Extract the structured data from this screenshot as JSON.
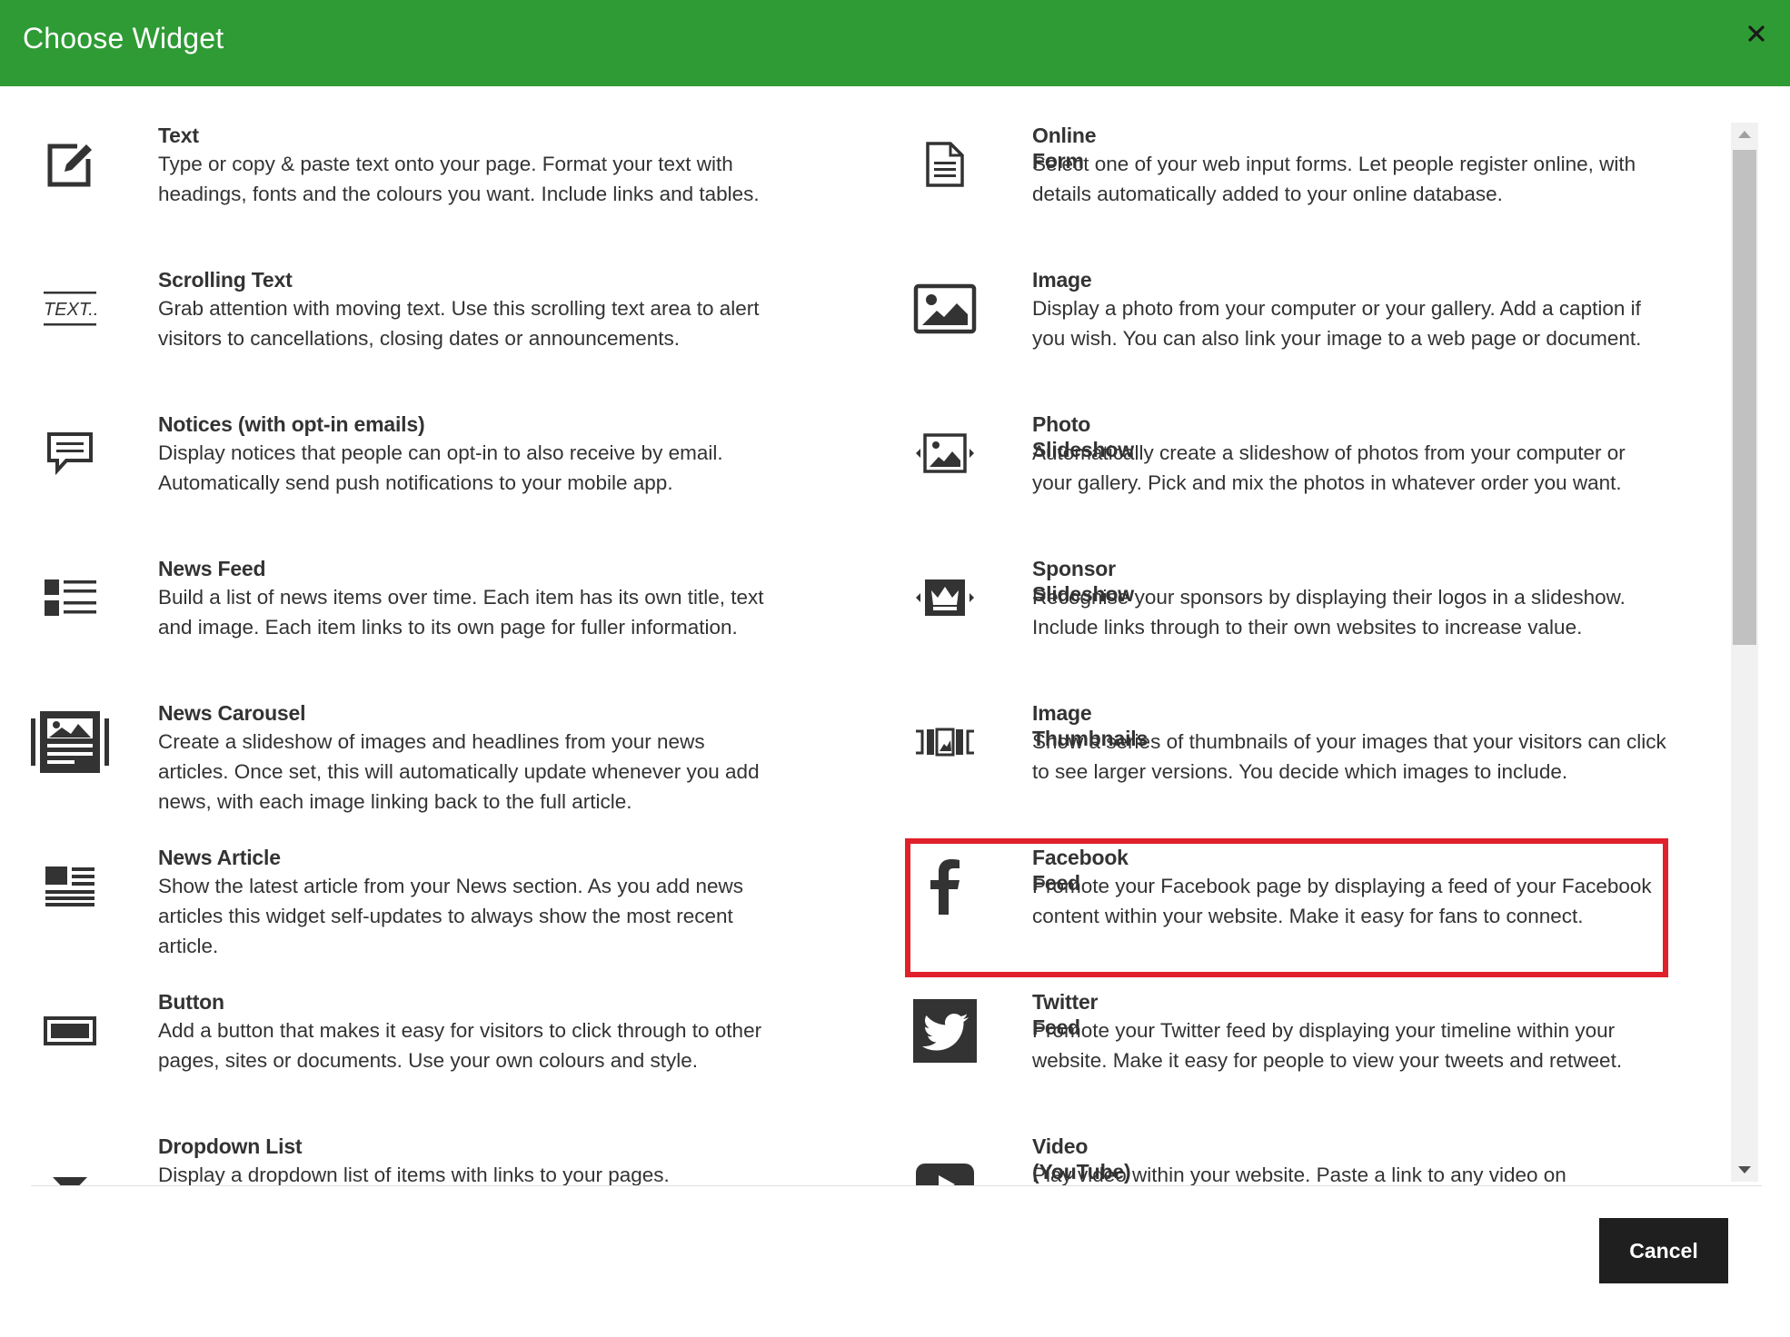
{
  "dialog": {
    "title": "Choose Widget",
    "close_icon": "close-icon",
    "cancel_label": "Cancel",
    "accent_color": "#2e9b35",
    "highlight_color": "#e0202a"
  },
  "widgets_left": [
    {
      "title": "Text",
      "desc": "Type or copy & paste text onto your page. Format your text with headings, fonts and the colours you want. Include links and tables.",
      "icon": "edit-icon"
    },
    {
      "title": "Scrolling Text",
      "desc": "Grab attention with moving text. Use this scrolling text area to alert visitors to cancellations, closing dates or announcements.",
      "icon": "scrolling-text-icon",
      "icon_text": "TEXT..."
    },
    {
      "title": "Notices (with opt-in emails)",
      "desc": "Display notices that people can opt-in to also receive by email. Automatically send push notifications to your mobile app.",
      "icon": "comment-icon"
    },
    {
      "title": "News Feed",
      "desc": "Build a list of news items over time. Each item has its own title, text and image. Each item links to its own page for fuller information.",
      "icon": "list-icon"
    },
    {
      "title": "News Carousel",
      "desc": "Create a slideshow of images and headlines from your news articles. Once set, this will automatically update whenever you add news, with each image linking back to the full article.",
      "icon": "carousel-icon"
    },
    {
      "title": "News Article",
      "desc": "Show the latest article from your News section. As you add news articles this widget self-updates to always show the most recent article.",
      "icon": "article-icon"
    },
    {
      "title": "Button",
      "desc": "Add a button that makes it easy for visitors to click through to other pages, sites or documents. Use your own colours and style.",
      "icon": "button-icon"
    },
    {
      "title": "Dropdown List",
      "desc": "Display a dropdown list of items with links to your pages.",
      "icon": "caret-down-icon"
    }
  ],
  "widgets_right": [
    {
      "title": "Online Form",
      "desc": "Select one of your web input forms. Let people register online, with details automatically added to your online database.",
      "icon": "document-icon"
    },
    {
      "title": "Image",
      "desc": "Display a photo from your computer or your gallery. Add a caption if you wish. You can also link your image to a web page or document.",
      "icon": "image-icon"
    },
    {
      "title": "Photo Slideshow",
      "desc": "Automatically create a slideshow of photos from your computer or your gallery. Pick and mix the photos in whatever order you want.",
      "icon": "photo-slideshow-icon"
    },
    {
      "title": "Sponsor Slideshow",
      "desc": "Recognise your sponsors by displaying their logos in a slideshow. Include links through to their own websites to increase value.",
      "icon": "sponsor-slideshow-icon"
    },
    {
      "title": "Image Thumbnails",
      "desc": "Show a series of thumbnails of your images that your visitors can click to see larger versions. You decide which images to include.",
      "icon": "thumbnails-icon"
    },
    {
      "title": "Facebook Feed",
      "desc": "Promote your Facebook page by displaying a feed of your Facebook content within your website. Make it easy for fans to connect.",
      "icon": "facebook-icon"
    },
    {
      "title": "Twitter Feed",
      "desc": "Promote your Twitter feed by displaying your timeline within your website. Make it easy for people to view your tweets and retweet.",
      "icon": "twitter-icon"
    },
    {
      "title": "Video (YouTube)",
      "desc": "Play video within your website. Paste a link to any video on",
      "icon": "youtube-icon"
    }
  ]
}
